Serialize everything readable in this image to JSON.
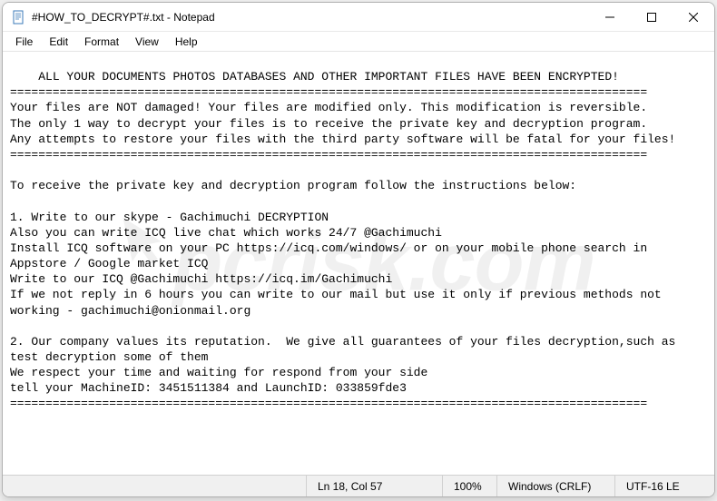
{
  "window": {
    "title": "#HOW_TO_DECRYPT#.txt - Notepad"
  },
  "menu": {
    "file": "File",
    "edit": "Edit",
    "format": "Format",
    "view": "View",
    "help": "Help"
  },
  "content": {
    "text": "ALL YOUR DOCUMENTS PHOTOS DATABASES AND OTHER IMPORTANT FILES HAVE BEEN ENCRYPTED!\n==========================================================================================\nYour files are NOT damaged! Your files are modified only. This modification is reversible.\nThe only 1 way to decrypt your files is to receive the private key and decryption program.\nAny attempts to restore your files with the third party software will be fatal for your files!\n==========================================================================================\n\nTo receive the private key and decryption program follow the instructions below:\n\n1. Write to our skype - Gachimuchi DECRYPTION\nAlso you can write ICQ live chat which works 24/7 @Gachimuchi\nInstall ICQ software on your PC https://icq.com/windows/ or on your mobile phone search in Appstore / Google market ICQ\nWrite to our ICQ @Gachimuchi https://icq.im/Gachimuchi\nIf we not reply in 6 hours you can write to our mail but use it only if previous methods not working - gachimuchi@onionmail.org\n\n2. Our company values its reputation.  We give all guarantees of your files decryption,such as test decryption some of them\nWe respect your time and waiting for respond from your side\ntell your MachineID: 3451511384 and LaunchID: 033859fde3\n=========================================================================================="
  },
  "status": {
    "position": "Ln 18, Col 57",
    "zoom": "100%",
    "eol": "Windows (CRLF)",
    "encoding": "UTF-16 LE"
  },
  "watermark": {
    "text": "pcrisk.com"
  }
}
